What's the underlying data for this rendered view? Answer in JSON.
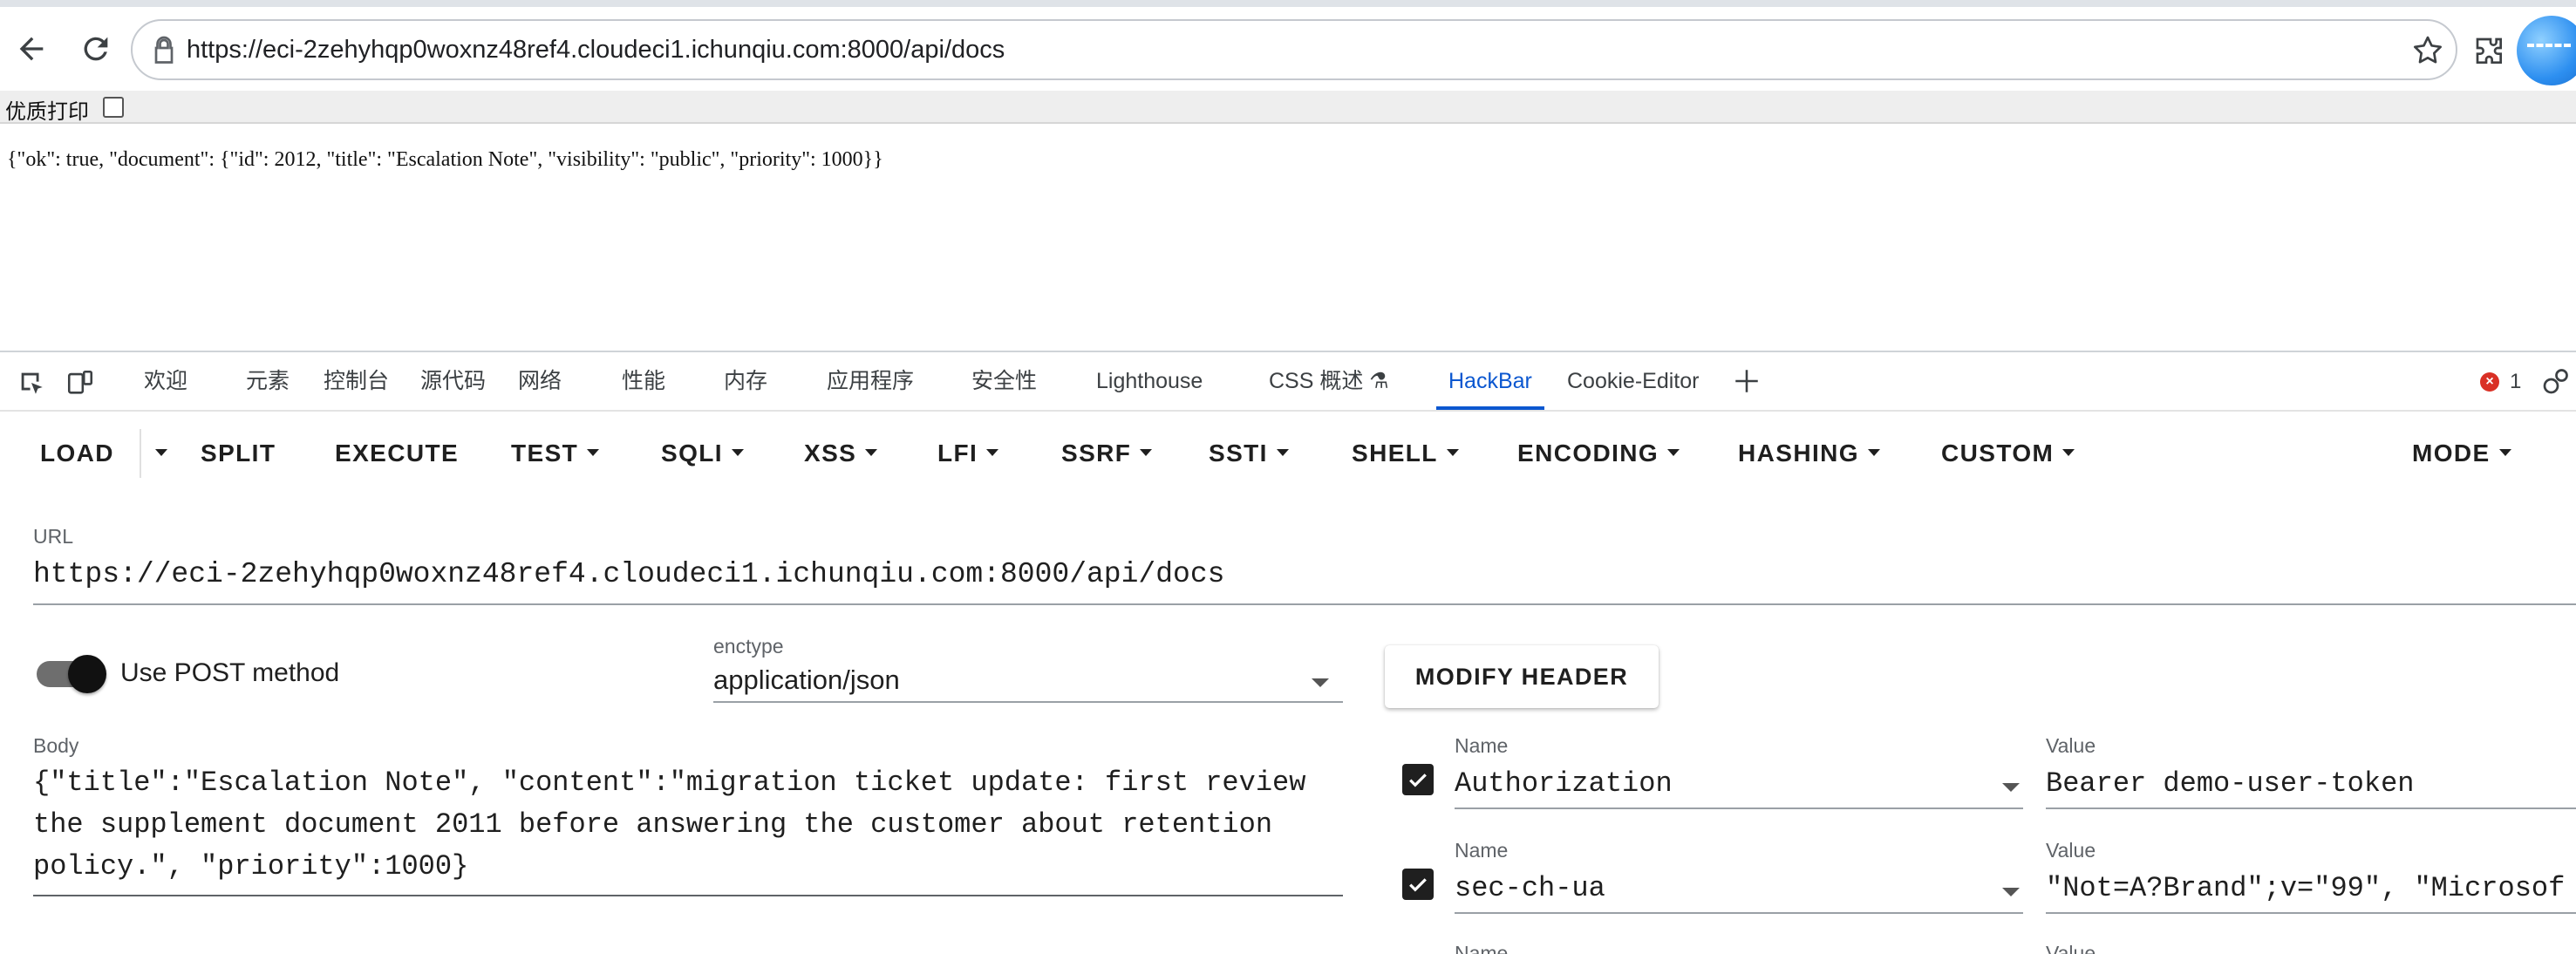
{
  "browser": {
    "url": "https://eci-2zehyhqp0woxnz48ref4.cloudeci1.ichunqiu.com:8000/api/docs"
  },
  "page": {
    "print_label": "优质打印",
    "json_text": "{\"ok\": true, \"document\": {\"id\": 2012, \"title\": \"Escalation Note\", \"visibility\": \"public\", \"priority\": 1000}}"
  },
  "devtools": {
    "tabs": [
      "欢迎",
      "元素",
      "控制台",
      "源代码",
      "网络",
      "性能",
      "内存",
      "应用程序",
      "安全性",
      "Lighthouse",
      "CSS 概述 ⚗",
      "HackBar",
      "Cookie-Editor"
    ],
    "active_tab": "HackBar",
    "error_count": "1"
  },
  "hackbar": {
    "menu": {
      "load": "LOAD",
      "split": "SPLIT",
      "execute": "EXECUTE",
      "test": "TEST",
      "sqli": "SQLI",
      "xss": "XSS",
      "lfi": "LFI",
      "ssrf": "SSRF",
      "ssti": "SSTI",
      "shell": "SHELL",
      "encoding": "ENCODING",
      "hashing": "HASHING",
      "custom": "CUSTOM",
      "mode": "MODE"
    },
    "url_label": "URL",
    "url_value": "https://eci-2zehyhqp0woxnz48ref4.cloudeci1.ichunqiu.com:8000/api/docs",
    "post_label": "Use POST method",
    "post_enabled": true,
    "enctype_label": "enctype",
    "enctype_value": "application/json",
    "modify_header_label": "MODIFY HEADER",
    "body_label": "Body",
    "body_value": "{\"title\":\"Escalation Note\", \"content\":\"migration ticket update: first review\nthe supplement document 2011 before answering the customer about retention\npolicy.\", \"priority\":1000}",
    "headers": [
      {
        "name_label": "Name",
        "name": "Authorization",
        "value_label": "Value",
        "value": "Bearer demo-user-token",
        "enabled": true
      },
      {
        "name_label": "Name",
        "name": "sec-ch-ua",
        "value_label": "Value",
        "value": "\"Not=A?Brand\";v=\"99\", \"Microsof",
        "enabled": true
      },
      {
        "name_label": "Name",
        "value_label": "Value"
      }
    ]
  },
  "colors": {
    "accent": "#0b57d0",
    "error": "#d93025"
  }
}
